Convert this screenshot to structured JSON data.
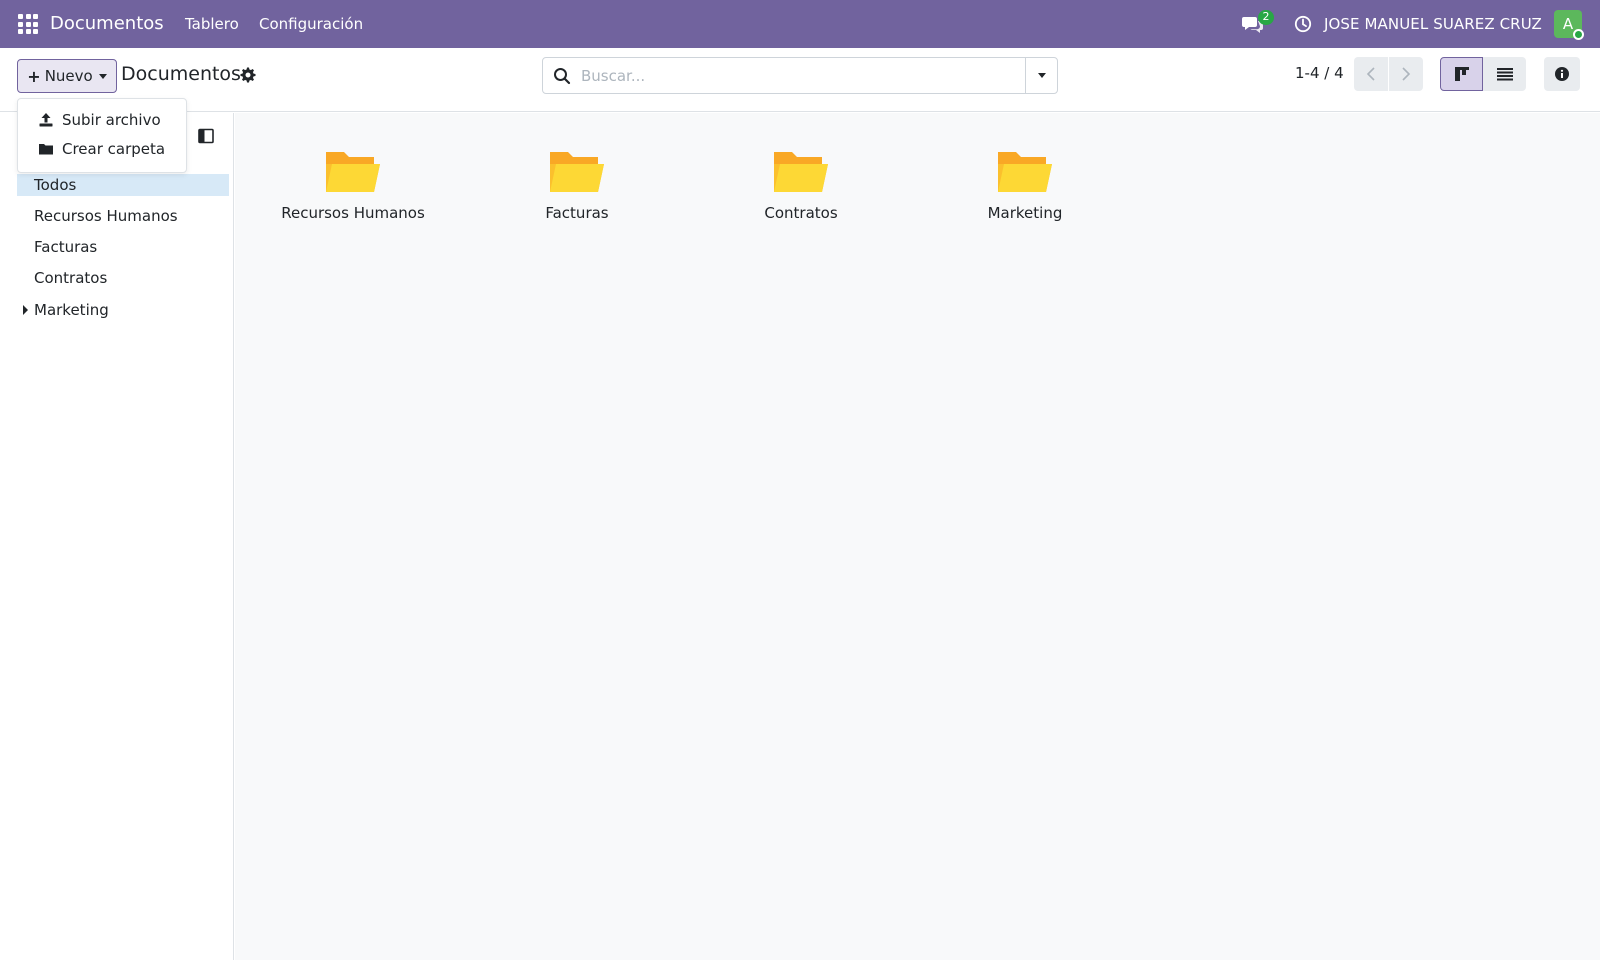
{
  "navbar": {
    "brand": "Documentos",
    "menu": [
      "Tablero",
      "Configuración"
    ],
    "chat_count": "2",
    "user_name": "JOSE MANUEL SUAREZ CRUZ",
    "avatar_letter": "A"
  },
  "control_panel": {
    "new_label": "Nuevo",
    "breadcrumb": "Documentos",
    "search_placeholder": "Buscar...",
    "pager": "1-4 / 4"
  },
  "new_menu": {
    "items": [
      "Subir archivo",
      "Crear carpeta"
    ]
  },
  "sidebar": {
    "items": [
      "Todos",
      "Recursos Humanos",
      "Facturas",
      "Contratos",
      "Marketing"
    ],
    "active": "Todos"
  },
  "folders": [
    "Recursos Humanos",
    "Facturas",
    "Contratos",
    "Marketing"
  ],
  "colors": {
    "navbar": "#71639e",
    "active_item": "#d7e9f7",
    "folder": "#fbc02d"
  },
  "icons": [
    "apps-grid-icon",
    "chat-icon",
    "clock-icon",
    "plus-icon",
    "gear-icon",
    "search-icon",
    "chevron-left-icon",
    "chevron-right-icon",
    "kanban-view-icon",
    "list-view-icon",
    "info-icon",
    "sidebar-toggle-icon",
    "upload-icon",
    "folder-icon"
  ]
}
